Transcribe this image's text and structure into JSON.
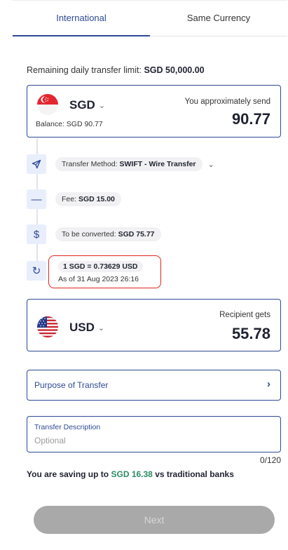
{
  "tabs": [
    {
      "label": "International",
      "active": true
    },
    {
      "label": "Same Currency",
      "active": false
    }
  ],
  "limit": {
    "label": "Remaining daily transfer limit:",
    "value": "SGD 50,000.00"
  },
  "send": {
    "currency": "SGD",
    "balance": "Balance: SGD 90.77",
    "amount_label": "You approximately send",
    "amount": "90.77",
    "flag": "singapore-flag"
  },
  "steps": {
    "method": {
      "label": "Transfer Method:",
      "value": "SWIFT - Wire Transfer",
      "icon": "send-icon"
    },
    "fee": {
      "label": "Fee:",
      "value": "SGD 15.00",
      "icon": "minus-icon"
    },
    "converted": {
      "label": "To be converted:",
      "value": "SGD 75.77",
      "icon": "dollar-icon"
    },
    "rate": {
      "value": "1 SGD = 0.73629 USD",
      "as_of": "As of 31 Aug 2023 26:16",
      "icon": "refresh-icon"
    }
  },
  "receive": {
    "currency": "USD",
    "amount_label": "Recipient gets",
    "amount": "55.78",
    "flag": "usa-flag"
  },
  "purpose": {
    "label": "Purpose of Transfer"
  },
  "description": {
    "label": "Transfer Description",
    "placeholder": "Optional",
    "value": "",
    "counter": "0/120"
  },
  "saving": {
    "prefix": "You are saving up to",
    "amount": "SGD 16.38",
    "suffix": "vs traditional banks"
  },
  "next_button": {
    "label": "Next",
    "disabled": true
  },
  "colors": {
    "accent": "#2e4a96",
    "highlight_border": "#e0241f",
    "saving_green": "#2b8a63",
    "disabled_button": "#a9a9a9"
  }
}
